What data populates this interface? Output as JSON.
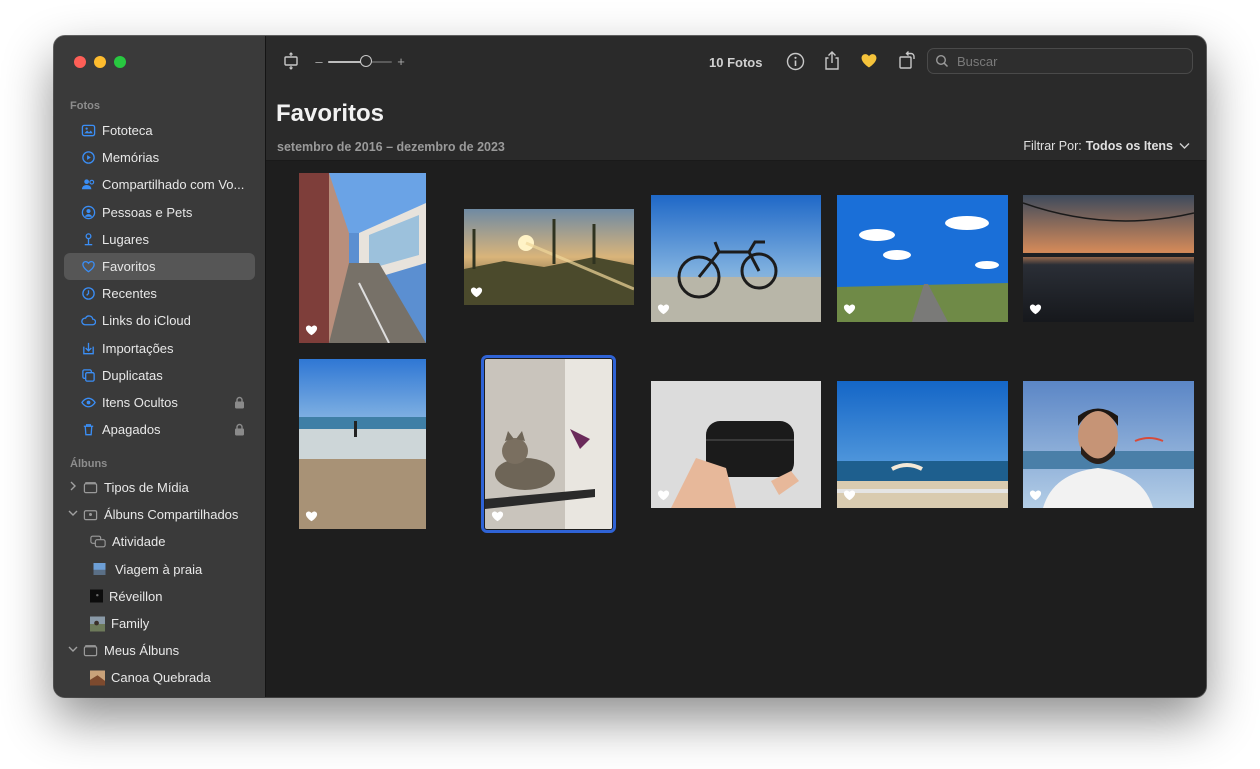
{
  "sidebar": {
    "section_fotos": "Fotos",
    "items": [
      {
        "label": "Fototeca",
        "icon": "photo-library-icon"
      },
      {
        "label": "Memórias",
        "icon": "memories-icon"
      },
      {
        "label": "Compartilhado com Vo...",
        "icon": "shared-with-you-icon"
      },
      {
        "label": "Pessoas e Pets",
        "icon": "people-icon"
      },
      {
        "label": "Lugares",
        "icon": "places-pin-icon"
      },
      {
        "label": "Favoritos",
        "icon": "heart-icon",
        "selected": true
      },
      {
        "label": "Recentes",
        "icon": "clock-icon"
      },
      {
        "label": "Links do iCloud",
        "icon": "cloud-link-icon"
      },
      {
        "label": "Importações",
        "icon": "import-icon"
      },
      {
        "label": "Duplicatas",
        "icon": "duplicates-icon"
      },
      {
        "label": "Itens Ocultos",
        "icon": "eye-icon",
        "locked": true
      },
      {
        "label": "Apagados",
        "icon": "trash-icon",
        "locked": true
      }
    ],
    "section_albuns": "Álbuns",
    "albums": [
      {
        "label": "Tipos de Mídia",
        "chevron": "›"
      },
      {
        "label": "Álbuns Compartilhados",
        "chevron": "⌄"
      },
      {
        "label": "Atividade"
      },
      {
        "label": "Viagem à praia"
      },
      {
        "label": "Réveillon"
      },
      {
        "label": "Family"
      },
      {
        "label": "Meus Álbuns",
        "chevron": "⌄"
      },
      {
        "label": "Canoa Quebrada"
      }
    ]
  },
  "toolbar": {
    "zoom_minus": "–",
    "zoom_plus": "+",
    "zoom_level": 0.6,
    "count": "10 Fotos",
    "search_placeholder": "Buscar"
  },
  "header": {
    "title": "Favoritos",
    "date_range": "setembro de 2016 – dezembro de 2023",
    "filter_label": "Filtrar Por:",
    "filter_value": "Todos os Itens"
  },
  "photos": [
    {
      "name": "street-colonial-houses",
      "favorite": true
    },
    {
      "name": "sunset-cactus",
      "favorite": true
    },
    {
      "name": "bicycle-beach",
      "favorite": true
    },
    {
      "name": "road-blue-sky",
      "favorite": true
    },
    {
      "name": "lake-sunset",
      "favorite": true
    },
    {
      "name": "beach-shore",
      "favorite": true
    },
    {
      "name": "cat-on-shelf",
      "favorite": true,
      "selected": true
    },
    {
      "name": "earbuds-case",
      "favorite": true
    },
    {
      "name": "paraglider-sea",
      "favorite": true
    },
    {
      "name": "selfie-beach",
      "favorite": true
    }
  ],
  "colors": {
    "accent": "#2f63d6",
    "favorite": "#f5c33b",
    "sidebar_bg": "#3a3a3a",
    "content_bg": "#1e1e1e"
  }
}
